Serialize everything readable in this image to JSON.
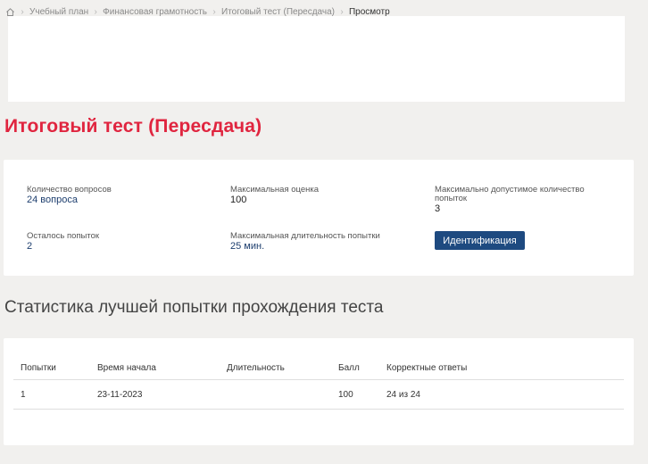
{
  "breadcrumb": {
    "items": [
      "Учебный план",
      "Финансовая грамотность",
      "Итоговый тест (Пересдача)"
    ],
    "current": "Просмотр"
  },
  "page": {
    "title": "Итоговый тест (Пересдача)"
  },
  "info": {
    "questions_label": "Количество вопросов",
    "questions_value": "24 вопроса",
    "max_score_label": "Максимальная оценка",
    "max_score_value": "100",
    "max_attempts_label": "Максимально допустимое количество попыток",
    "max_attempts_value": "3",
    "remaining_label": "Осталось попыток",
    "remaining_value": "2",
    "duration_label": "Максимальная длительность попытки",
    "duration_value": "25 мин.",
    "identify_button": "Идентификация"
  },
  "stats": {
    "title": "Статистика лучшей попытки прохождения теста",
    "columns": [
      "Попытки",
      "Время начала",
      "Длительность",
      "Балл",
      "Корректные ответы"
    ],
    "rows": [
      [
        "1",
        "23-11-2023",
        "",
        "100",
        "24 из 24"
      ]
    ]
  }
}
